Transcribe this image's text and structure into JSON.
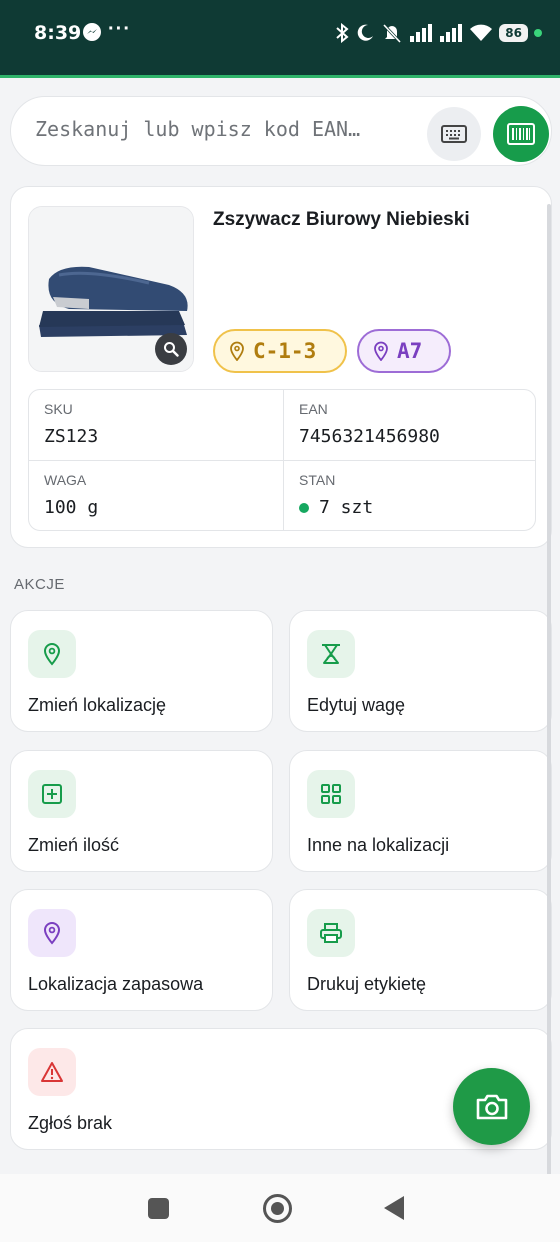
{
  "status_bar": {
    "time": "8:39",
    "battery": "86"
  },
  "search": {
    "placeholder": "Zeskanuj lub wpisz kod EAN…",
    "value": ""
  },
  "product": {
    "name": "Zszywacz Biurowy Niebieski",
    "locations": [
      {
        "code": "C-1-3",
        "color": "#f0c24a"
      },
      {
        "code": "A7",
        "color": "#9d6cd6"
      }
    ],
    "details": {
      "sku_label": "SKU",
      "sku_value": "ZS123",
      "ean_label": "EAN",
      "ean_value": "7456321456980",
      "weight_label": "WAGA",
      "weight_value": "100 g",
      "stock_label": "STAN",
      "stock_value": "7 szt"
    }
  },
  "actions_section": {
    "title": "AKCJE",
    "items": [
      {
        "label": "Zmień lokalizację",
        "icon": "location-pin-icon"
      },
      {
        "label": "Edytuj wagę",
        "icon": "scale-icon"
      },
      {
        "label": "Zmień ilość",
        "icon": "plus-square-icon"
      },
      {
        "label": "Inne na lokalizacji",
        "icon": "grid-icon"
      },
      {
        "label": "Lokalizacja zapasowa",
        "icon": "location-pin-icon"
      },
      {
        "label": "Drukuj etykietę",
        "icon": "printer-icon"
      },
      {
        "label": "Zgłoś brak",
        "icon": "warning-icon"
      }
    ]
  },
  "colors": {
    "accent_green": "#179c4b",
    "header_bg": "#0f3a34",
    "location_yellow": "#f0c24a",
    "location_purple": "#9d6cd6",
    "warning_red": "#d93636"
  }
}
